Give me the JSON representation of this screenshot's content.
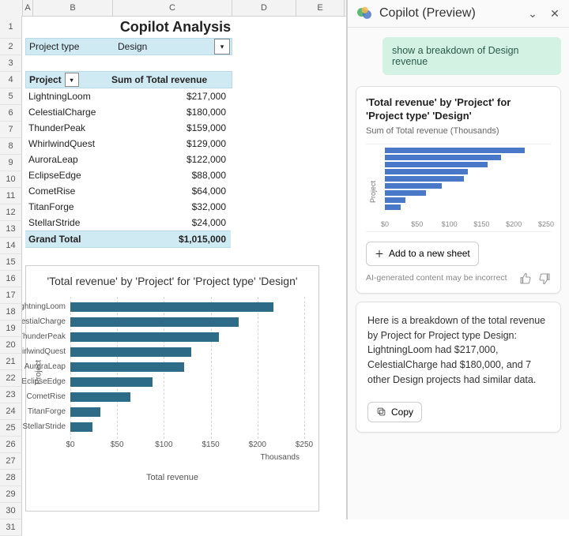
{
  "sheet": {
    "columns": [
      "A",
      "B",
      "C",
      "D",
      "E"
    ],
    "title": "Copilot Analysis",
    "filter_label": "Project type",
    "filter_value": "Design",
    "pivot_headers": {
      "col1": "Project",
      "col2": "Sum of Total revenue"
    },
    "rows": [
      {
        "name": "LightningLoom",
        "val": "$217,000",
        "num": 217
      },
      {
        "name": "CelestialCharge",
        "val": "$180,000",
        "num": 180
      },
      {
        "name": "ThunderPeak",
        "val": "$159,000",
        "num": 159
      },
      {
        "name": "WhirlwindQuest",
        "val": "$129,000",
        "num": 129
      },
      {
        "name": "AuroraLeap",
        "val": "$122,000",
        "num": 122
      },
      {
        "name": "EclipseEdge",
        "val": "$88,000",
        "num": 88
      },
      {
        "name": "CometRise",
        "val": "$64,000",
        "num": 64
      },
      {
        "name": "TitanForge",
        "val": "$32,000",
        "num": 32
      },
      {
        "name": "StellarStride",
        "val": "$24,000",
        "num": 24
      }
    ],
    "total_label": "Grand Total",
    "total_value": "$1,015,000"
  },
  "chart_data": {
    "type": "bar",
    "orientation": "horizontal",
    "title": "'Total revenue' by 'Project' for 'Project type' 'Design'",
    "ylabel": "Project",
    "xlabel": "Total revenue",
    "x_sublabel": "Thousands",
    "categories": [
      "LightningLoom",
      "CelestialCharge",
      "ThunderPeak",
      "WhirlwindQuest",
      "AuroraLeap",
      "EclipseEdge",
      "CometRise",
      "TitanForge",
      "StellarStride"
    ],
    "values": [
      217,
      180,
      159,
      129,
      122,
      88,
      64,
      32,
      24
    ],
    "xlim": [
      0,
      250
    ],
    "xticks": [
      "$0",
      "$50",
      "$100",
      "$150",
      "$200",
      "$250"
    ]
  },
  "copilot": {
    "header": "Copilot (Preview)",
    "user_msg": "show a breakdown of Design revenue",
    "card_title": "'Total revenue' by 'Project' for 'Project type' 'Design'",
    "card_subtitle": "Sum of Total revenue (Thousands)",
    "mini_y": "Project",
    "mini_xticks": [
      "$0",
      "$50",
      "$100",
      "$150",
      "$200",
      "$250"
    ],
    "mini_values": [
      217,
      180,
      159,
      129,
      122,
      88,
      64,
      32,
      24
    ],
    "mini_xmax": 250,
    "add_btn": "Add to a new sheet",
    "disclaimer": "AI-generated content may be incorrect",
    "summary": "Here is a breakdown of the total revenue by Project for Project type Design: LightningLoom had $217,000, CelestialCharge had $180,000, and 7 other Design projects had similar data.",
    "copy_btn": "Copy"
  }
}
